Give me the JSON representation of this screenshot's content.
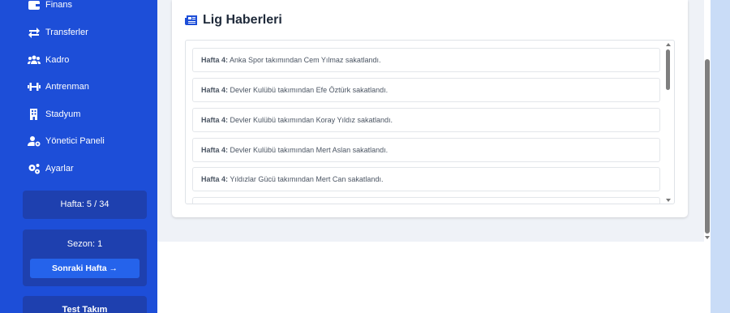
{
  "sidebar": {
    "items": [
      {
        "label": "Finans",
        "icon": "wallet-icon"
      },
      {
        "label": "Transferler",
        "icon": "arrows-exchange-icon"
      },
      {
        "label": "Kadro",
        "icon": "users-icon"
      },
      {
        "label": "Antrenman",
        "icon": "dumbbell-icon"
      },
      {
        "label": "Stadyum",
        "icon": "building-icon"
      },
      {
        "label": "Yönetici Paneli",
        "icon": "user-gear-icon"
      },
      {
        "label": "Ayarlar",
        "icon": "gears-icon"
      }
    ],
    "week_label": "Hafta: 5 / 34",
    "season_label": "Sezon: 1",
    "next_week_button": "Sonraki Hafta →",
    "team_name": "Test Takım"
  },
  "news": {
    "title": "Lig Haberleri",
    "items": [
      {
        "week": "Hafta 4:",
        "text": "Anka Spor takımından Cem Yılmaz sakatlandı."
      },
      {
        "week": "Hafta 4:",
        "text": "Devler Kulübü takımından Efe Öztürk sakatlandı."
      },
      {
        "week": "Hafta 4:",
        "text": "Devler Kulübü takımından Koray Yıldız sakatlandı."
      },
      {
        "week": "Hafta 4:",
        "text": "Devler Kulübü takımından Mert Aslan sakatlandı."
      },
      {
        "week": "Hafta 4:",
        "text": "Yıldızlar Gücü takımından Mert Can sakatlandı."
      }
    ]
  },
  "colors": {
    "sidebar": "#1d4ed8",
    "card": "#1e40af",
    "button": "#2563eb",
    "page_background": "#eff2f7"
  }
}
